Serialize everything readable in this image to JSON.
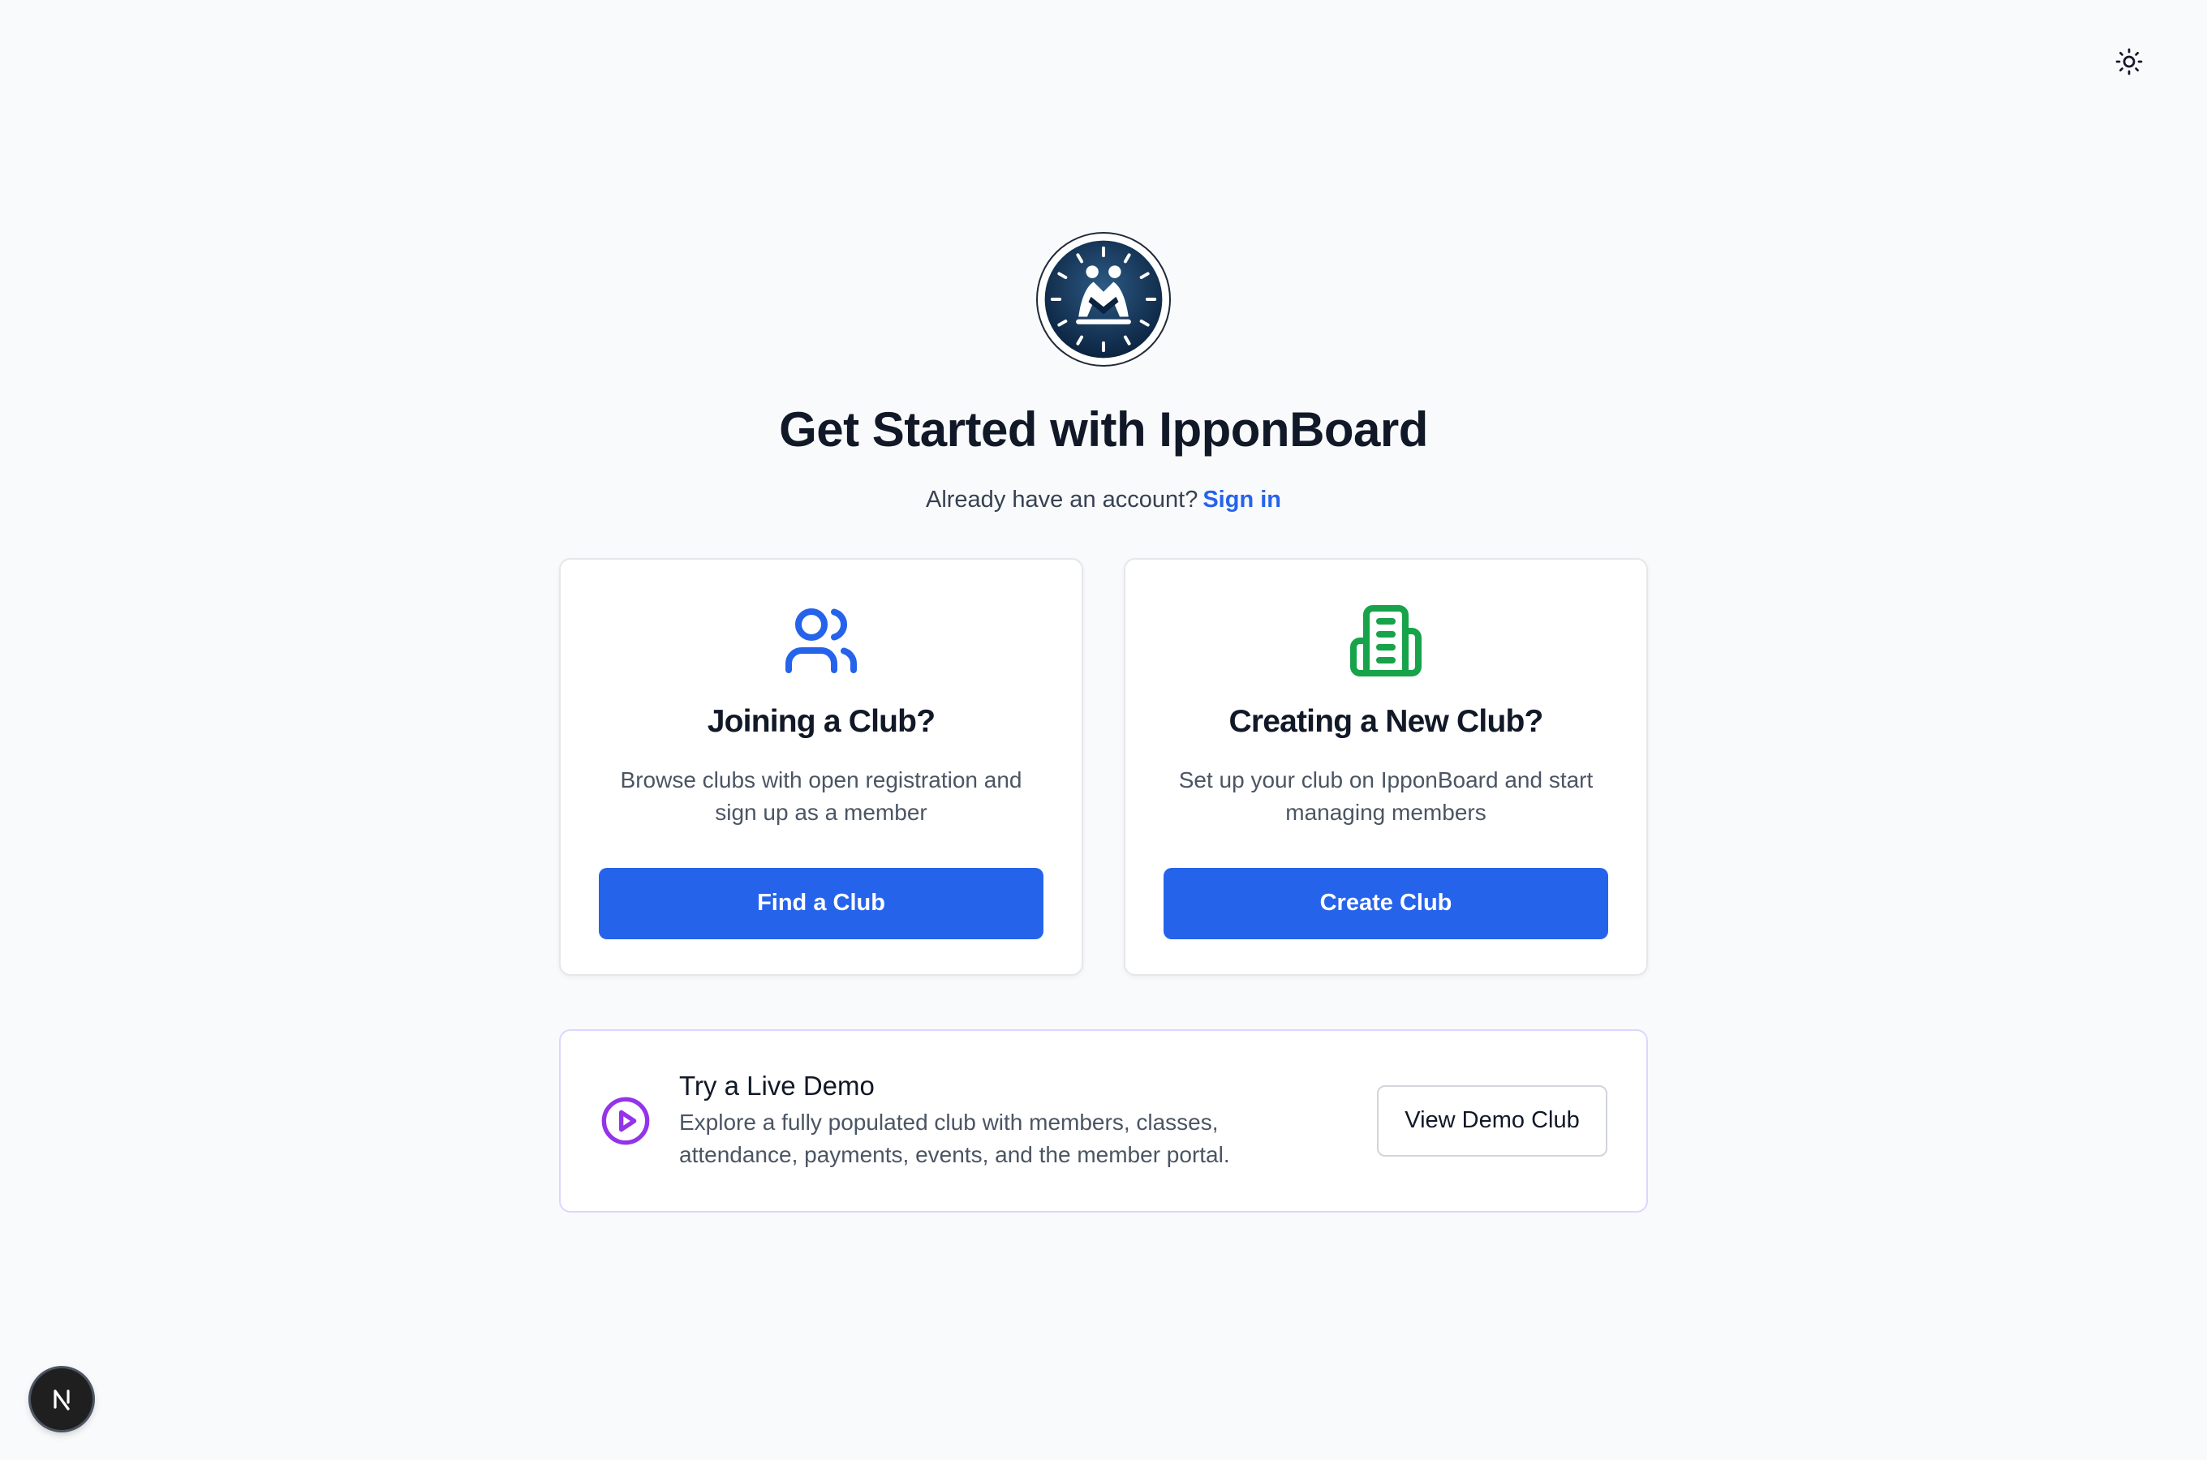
{
  "header": {
    "theme_toggle_icon": "sun-icon"
  },
  "brand": {
    "logo_icon": "judo-clock-logo",
    "logo_colors": {
      "dark": "#0f2a47",
      "light": "#ffffff"
    }
  },
  "hero": {
    "title": "Get Started with IpponBoard",
    "subtitle_text": "Already have an account?",
    "signin_link": "Sign in"
  },
  "cards": [
    {
      "icon": "users-icon",
      "icon_color": "#2563eb",
      "title": "Joining a Club?",
      "description": "Browse clubs with open registration and sign up as a member",
      "button_label": "Find a Club"
    },
    {
      "icon": "building-icon",
      "icon_color": "#16a34a",
      "title": "Creating a New Club?",
      "description": "Set up your club on IpponBoard and start managing members",
      "button_label": "Create Club"
    }
  ],
  "demo": {
    "icon": "play-circle-icon",
    "icon_color": "#9333ea",
    "title": "Try a Live Demo",
    "description": "Explore a fully populated club with members, classes, attendance, payments, events, and the member portal.",
    "button_label": "View Demo Club"
  },
  "dev_badge": {
    "icon": "nextjs-icon",
    "label": "N"
  },
  "colors": {
    "primary": "#2563eb",
    "background": "#f9fafb",
    "demo_border": "#ddd6fe"
  }
}
